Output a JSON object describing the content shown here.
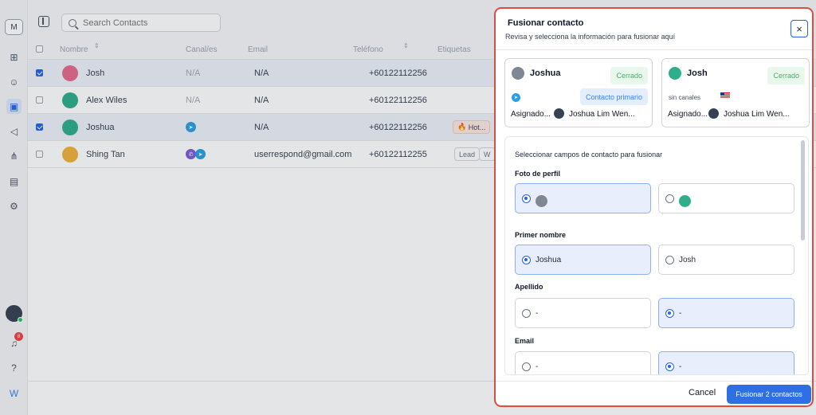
{
  "sidebar": {
    "brand_letter": "M",
    "notification_count": "8"
  },
  "search": {
    "placeholder": "Search Contacts"
  },
  "table": {
    "columns": {
      "name": "Nombre",
      "channels": "Canal/es",
      "email": "Email",
      "phone": "Teléfono",
      "tags": "Etiquetas"
    },
    "rows": [
      {
        "name": "Josh",
        "channels": "N/A",
        "email": "N/A",
        "phone": "+60122112256",
        "checked": true,
        "avatar_color": "#e56a8e"
      },
      {
        "name": "Alex Wiles",
        "channels": "N/A",
        "email": "N/A",
        "phone": "+60122112256",
        "checked": false,
        "avatar_color": "#2eae8a"
      },
      {
        "name": "Joshua",
        "channels": "",
        "email": "N/A",
        "phone": "+60122112256",
        "checked": true,
        "avatar_color": "#2eae8a",
        "tag": "Hot..."
      },
      {
        "name": "Shing Tan",
        "channels": "",
        "email": "userrespond@gmail.com",
        "phone": "+60122112255",
        "checked": false,
        "avatar_color": "#f0b23c",
        "tag": "Lead",
        "tag2": "W"
      }
    ]
  },
  "modal": {
    "title": "Fusionar contacto",
    "subtitle": "Revisa y selecciona la información para fusionar aquí",
    "close_label": "×",
    "cards": [
      {
        "name": "Joshua",
        "status": "Cerrado",
        "primary_label": "Contacto primario",
        "assigned_label": "Asignado...",
        "agent": "Joshua Lim Wen...",
        "avatar_color": "#7e8792"
      },
      {
        "name": "Josh",
        "status": "Cerrado",
        "no_channels": "sin canales",
        "assigned_label": "Asignado...",
        "agent": "Joshua Lim Wen...",
        "avatar_color": "#2eae8a"
      }
    ],
    "fields_intro": "Seleccionar campos de contacto para fusionar",
    "fields": {
      "photo": {
        "label": "Foto de perfil"
      },
      "first_name": {
        "label": "Primer nombre",
        "left": "Joshua",
        "right": "Josh"
      },
      "last_name": {
        "label": "Apellido",
        "left": "-",
        "right": "-"
      },
      "email": {
        "label": "Email",
        "left": "-",
        "right": "-"
      }
    },
    "cancel_label": "Cancel",
    "merge_label": "Fusionar 2 contactos"
  },
  "colors": {
    "accent": "#2f6fe4",
    "highlight_border": "#e14b3b",
    "closed_text": "#4caf6a"
  }
}
